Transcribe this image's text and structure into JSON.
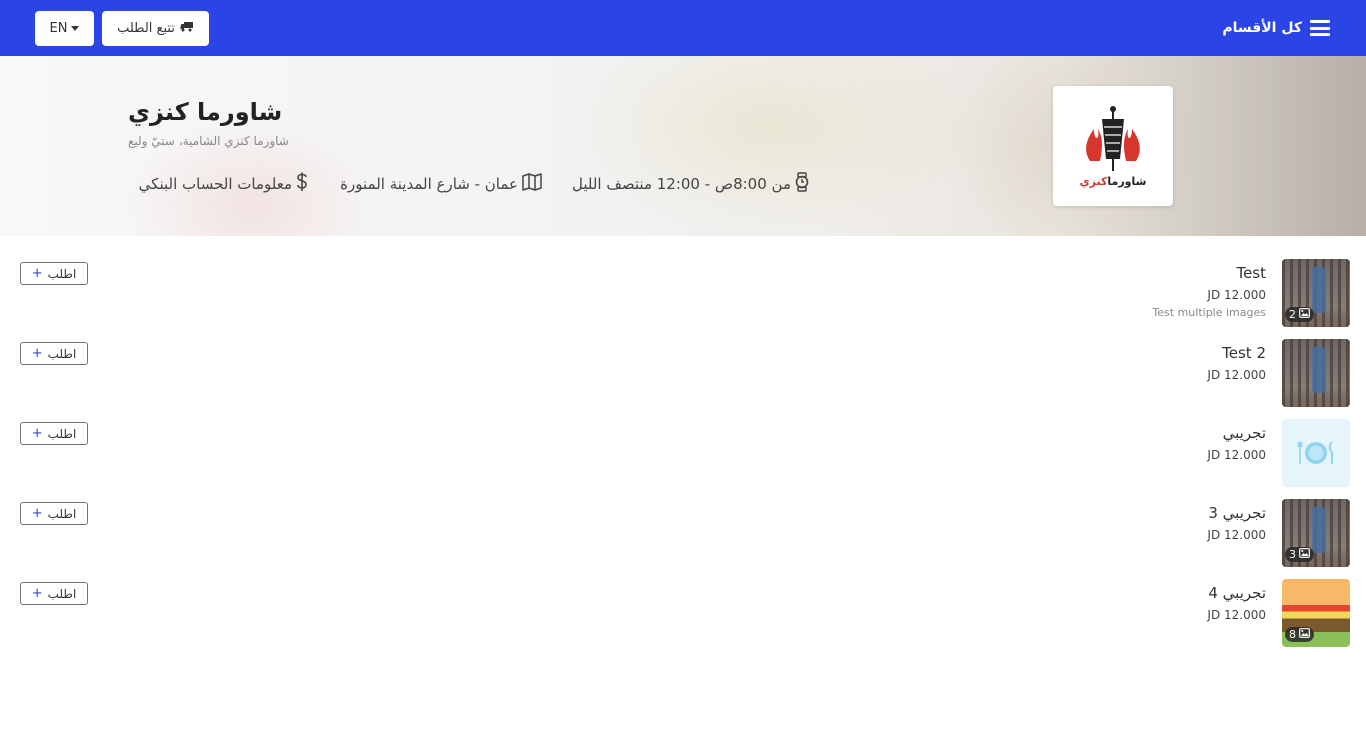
{
  "navbar": {
    "lang_label": "EN",
    "track_label": "تتبع الطلب",
    "menu_label": "كل الأقسام",
    "color": "#2b44e6"
  },
  "restaurant": {
    "name": "شاورما كنزي",
    "subtitle": "شاورما كنزي الشامية، ستيّ وليع",
    "hours": "من 8:00ص - 12:00 منتصف الليل",
    "address": "عمان - شارع المدينة المنورة",
    "bank_info": "معلومات الحساب البنكي",
    "logo_text": "شاورما كنزي"
  },
  "order_label": "اطلب",
  "items": [
    {
      "name": "Test",
      "price": "JD 12.000",
      "desc": "Test multiple images",
      "image_count": "2"
    },
    {
      "name": "Test 2",
      "price": "JD 12.000"
    },
    {
      "name": "تجريبي",
      "price": "JD 12.000"
    },
    {
      "name": "تجريبي 3",
      "price": "JD 12.000",
      "image_count": "3"
    },
    {
      "name": "تجريبي 4",
      "price": "JD 12.000",
      "image_count": "8"
    }
  ]
}
